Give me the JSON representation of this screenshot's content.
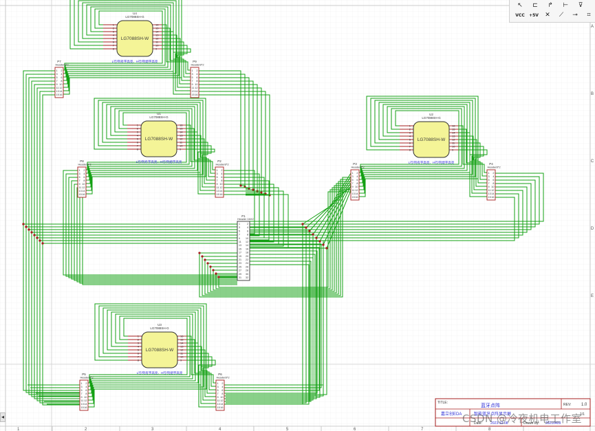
{
  "colors": {
    "wire": "#13a013",
    "pin": "#a61c1c",
    "chip_fill": "#f4f497",
    "chip_stroke": "#303030",
    "label_blue": "#2f2fd6",
    "grid": "#eaeaea",
    "border": "#a61c1c"
  },
  "toolbar": {
    "row1": [
      "pointer-icon",
      "port-icon",
      "arrow-icon",
      "bus-icon",
      "marker-icon"
    ],
    "row2": [
      {
        "name": "vcc-icon",
        "label": "VCC"
      },
      {
        "name": "plus5v-icon",
        "label": "+5V"
      },
      {
        "name": "no-connect-icon",
        "label": "✕"
      },
      {
        "name": "wire-icon",
        "label": "⟋"
      },
      {
        "name": "bus-entry-icon",
        "label": "⊸"
      },
      {
        "name": "label-icon",
        "label": "⌗"
      }
    ]
  },
  "left_tab": "◂",
  "ruler": {
    "top": [
      "1",
      "2",
      "3",
      "4",
      "5",
      "6",
      "7",
      "8"
    ],
    "bottom": [
      "1",
      "2",
      "3",
      "4",
      "5",
      "6",
      "7",
      "8"
    ],
    "right": [
      "A",
      "B",
      "C",
      "D",
      "E"
    ]
  },
  "matrices": [
    {
      "ref": "U4",
      "model": "LG7088SH-G",
      "part": "LG7088SH-W",
      "note": "L行/列有字高亮、H行/列熄字高亮"
    },
    {
      "ref": "U1",
      "model": "LG7088SH-G",
      "part": "LG7088SH-W",
      "note": "L行/列有字高亮、H行/列熄字高亮"
    },
    {
      "ref": "U2",
      "model": "LG7088SH-G",
      "part": "LG7088SH-W",
      "note": "L行/列有字高亮、H行/列熄字高亮"
    },
    {
      "ref": "U3",
      "model": "LG7088SH-G",
      "part": "LG7088SH-W",
      "note": "L行/列有字高亮、H行/列熄字高亮"
    }
  ],
  "matrix_pins_left": [
    "1",
    "2",
    "3",
    "4",
    "5",
    "6",
    "7",
    "8"
  ],
  "matrix_pins_right": [
    "16",
    "15",
    "14",
    "13",
    "12",
    "11",
    "10",
    "9"
  ],
  "headers": [
    {
      "ref": "P7",
      "name": "Header8*2"
    },
    {
      "ref": "P9",
      "name": "Header8*2"
    },
    {
      "ref": "P8",
      "name": "Header8*2"
    },
    {
      "ref": "P2",
      "name": "Header8*2"
    },
    {
      "ref": "P3",
      "name": "Header8*2"
    },
    {
      "ref": "P4",
      "name": "Header8*2"
    },
    {
      "ref": "P5",
      "name": "Header8*2"
    },
    {
      "ref": "P6",
      "name": "Header8*2"
    }
  ],
  "header_pins_left": [
    "1",
    "3",
    "5",
    "7",
    "9",
    "11",
    "13",
    "15"
  ],
  "header_pins_right": [
    "2",
    "4",
    "6",
    "8",
    "10",
    "12",
    "14",
    "16"
  ],
  "main_header": {
    "ref": "P1",
    "name": "Header 16X2"
  },
  "main_header_pins": [
    "1",
    "2",
    "3",
    "4",
    "5",
    "6",
    "7",
    "8",
    "9",
    "10",
    "11",
    "12",
    "13",
    "14",
    "15",
    "16",
    "17",
    "18",
    "19",
    "20",
    "21",
    "22",
    "23",
    "24",
    "25",
    "26",
    "27",
    "28",
    "29",
    "30",
    "31",
    "32"
  ],
  "title_block": {
    "title_label": "TITLE:",
    "title_value": "蓝牙点阵",
    "rev_label": "REV:",
    "rev_value": "1.0",
    "company": "嘉立创EDA",
    "company_value": "智能蓝牙点阵显示屏",
    "sheet": "1/1",
    "date_label": "Date:",
    "date_value": "2023-12-08",
    "drawn_label": "Drawn By:",
    "drawn_value": "20210409"
  },
  "watermark": "CSDN @冷夜机电工作室"
}
